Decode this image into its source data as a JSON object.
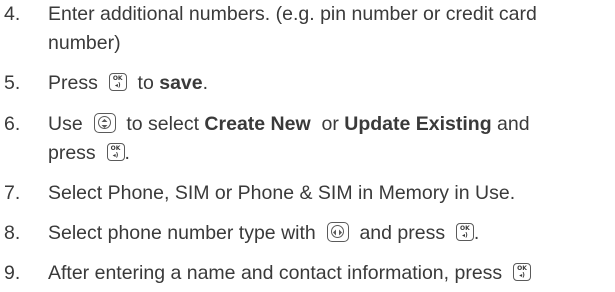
{
  "steps": [
    {
      "num": "4.",
      "line1": "Enter additional numbers. (e.g. pin number or credit card",
      "line2": "number)"
    },
    {
      "num": "5.",
      "text_a": "Press",
      "text_b": "to",
      "bold_a": "save",
      "text_c": "."
    },
    {
      "num": "6.",
      "text_a": "Use",
      "text_b": "to select",
      "bold_a": "Create New",
      "text_c": "or",
      "bold_b": "Update Existing",
      "text_d": "and",
      "line2_a": "press",
      "line2_b": "."
    },
    {
      "num": "7.",
      "text_a": "Select Phone, SIM or Phone & SIM in Memory in Use."
    },
    {
      "num": "8.",
      "text_a": "Select phone number type with",
      "text_b": "and press",
      "text_c": "."
    },
    {
      "num": "9.",
      "text_a": "After entering a name and contact information, press"
    }
  ],
  "icons": {
    "ok_key": {
      "name": "ok-key-icon",
      "top_label": "OK",
      "bottom_label": "◂)"
    },
    "nav_up_down": {
      "name": "nav-up-down-icon"
    },
    "nav_left_right": {
      "name": "nav-left-right-icon"
    }
  }
}
